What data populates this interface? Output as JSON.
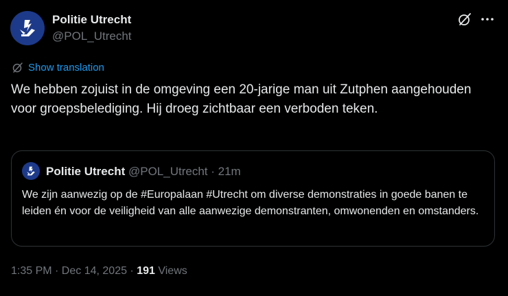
{
  "author": {
    "display_name": "Politie Utrecht",
    "handle": "@POL_Utrecht"
  },
  "icons": {
    "avatar": "police-logo",
    "grok": "grok-icon",
    "more": "more-options-icon",
    "translate": "translate-icon"
  },
  "translate": {
    "label": "Show translation"
  },
  "tweet": {
    "text": "We hebben zojuist in de omgeving een 20-jarige man uit Zutphen aangehouden voor groepsbelediging. Hij droeg zichtbaar een verboden teken."
  },
  "quote": {
    "display_name": "Politie Utrecht",
    "meta": "@POL_Utrecht · 21m",
    "text": "We zijn aanwezig op de #Europalaan #Utrecht om diverse demonstraties in goede banen te leiden én voor de veiligheid van alle aanwezige demonstranten, omwonenden en omstanders."
  },
  "footer": {
    "timestamp": "1:35 PM · Dec 14, 2025 · ",
    "views_count": "191",
    "views_label": " Views"
  },
  "colors": {
    "background": "#000000",
    "text": "#e7e9ea",
    "secondary": "#71767b",
    "link": "#1d9bf0",
    "border": "#2f3336",
    "avatar_bg": "#1d3a8a"
  }
}
